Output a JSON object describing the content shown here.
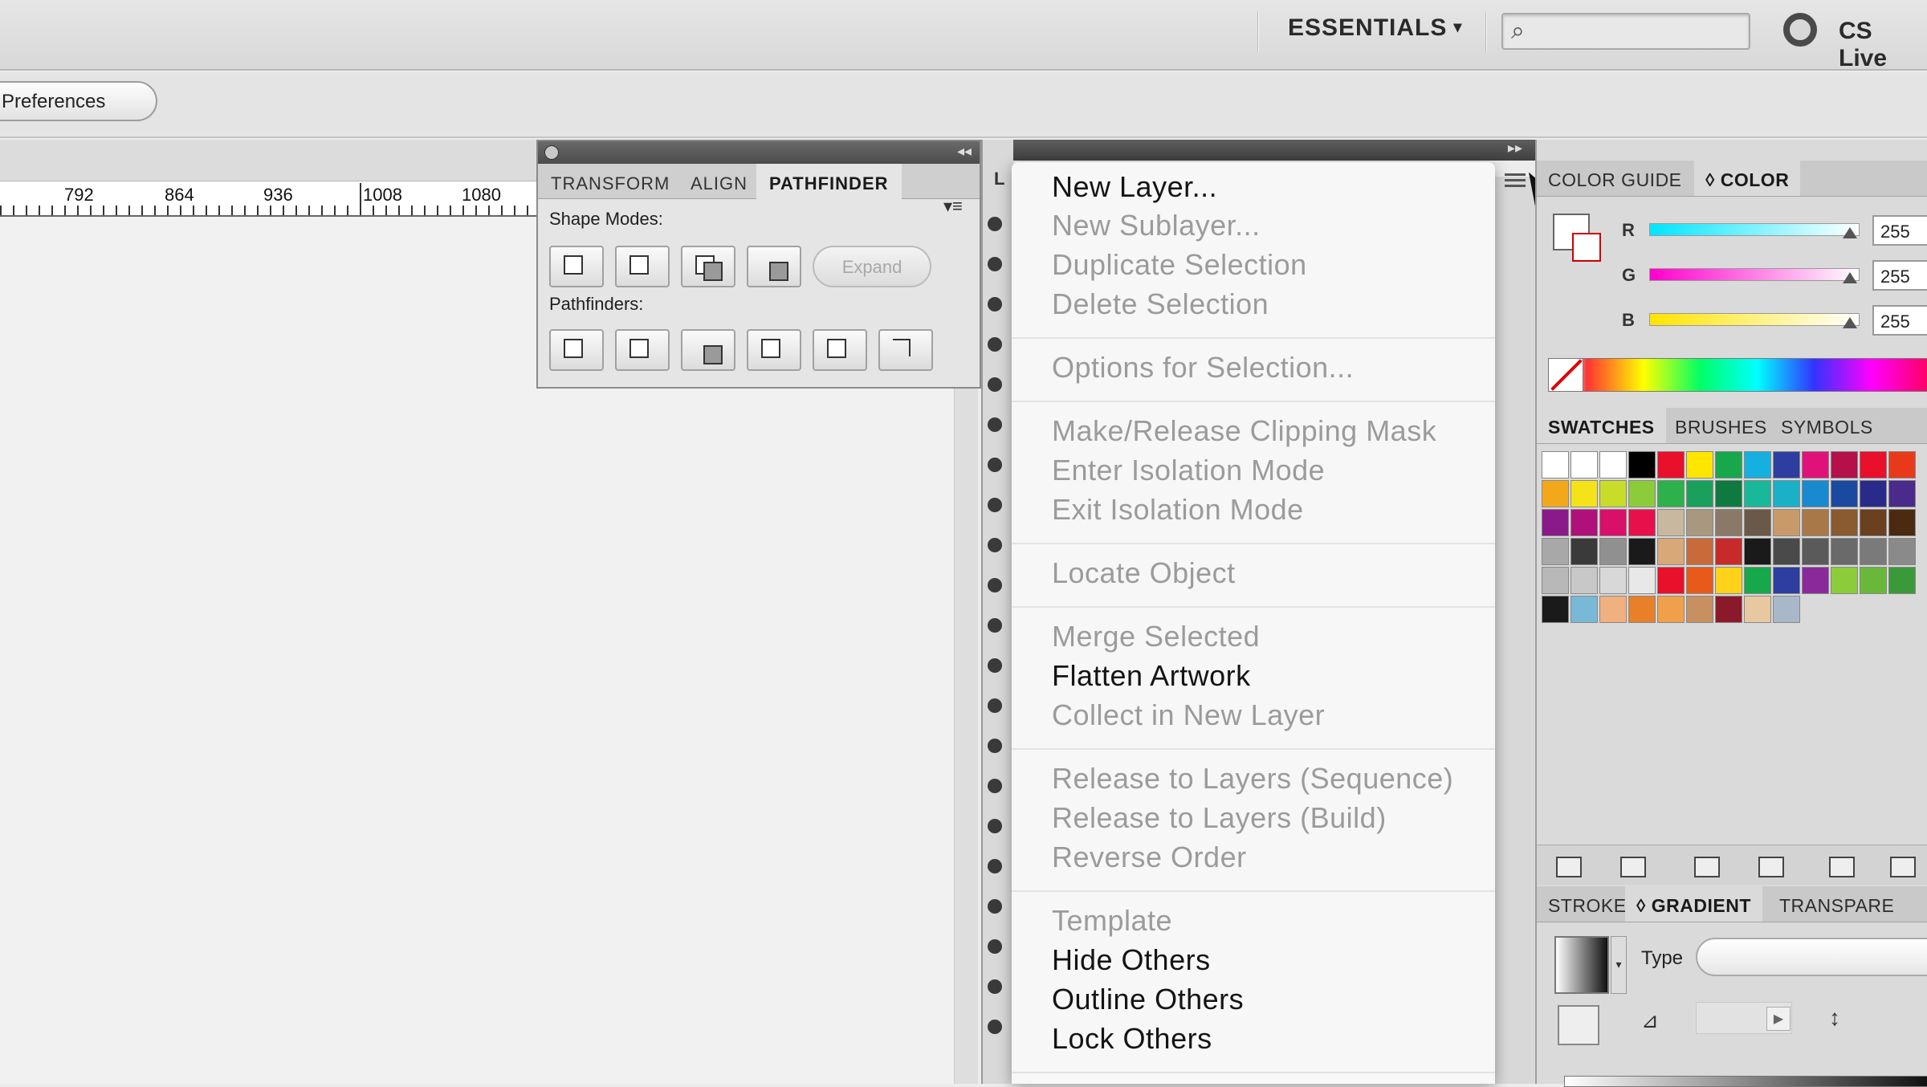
{
  "appbar": {
    "workspace": "ESSENTIALS",
    "workspace_caret": "▾",
    "search_placeholder": "",
    "search_icon": "⌕",
    "cs_live": "CS Live"
  },
  "controlbar": {
    "preferences": "Preferences"
  },
  "ruler": {
    "labels": [
      "792",
      "864",
      "936",
      "1008",
      "1080"
    ]
  },
  "pathfinder": {
    "tabs": [
      "TRANSFORM",
      "ALIGN",
      "PATHFINDER"
    ],
    "active_tab": "PATHFINDER",
    "shape_modes_label": "Shape Modes:",
    "pathfinders_label": "Pathfinders:",
    "expand": "Expand",
    "menu_icon": "▾≡"
  },
  "layers_menu": {
    "header_letter": "L",
    "items": [
      {
        "label": "New Layer...",
        "enabled": true
      },
      {
        "label": "New Sublayer...",
        "enabled": false
      },
      {
        "label": "Duplicate Selection",
        "enabled": false
      },
      {
        "label": "Delete Selection",
        "enabled": false
      },
      {
        "label": "Options for Selection...",
        "enabled": false
      },
      {
        "label": "Make/Release Clipping Mask",
        "enabled": false
      },
      {
        "label": "Enter Isolation Mode",
        "enabled": false
      },
      {
        "label": "Exit Isolation Mode",
        "enabled": false
      },
      {
        "label": "Locate Object",
        "enabled": false
      },
      {
        "label": "Merge Selected",
        "enabled": false
      },
      {
        "label": "Flatten Artwork",
        "enabled": true
      },
      {
        "label": "Collect in New Layer",
        "enabled": false
      },
      {
        "label": "Release to Layers (Sequence)",
        "enabled": false
      },
      {
        "label": "Release to Layers (Build)",
        "enabled": false
      },
      {
        "label": "Reverse Order",
        "enabled": false
      },
      {
        "label": "Template",
        "enabled": false
      },
      {
        "label": "Hide Others",
        "enabled": true
      },
      {
        "label": "Outline Others",
        "enabled": true
      },
      {
        "label": "Lock Others",
        "enabled": true
      }
    ]
  },
  "color_panel": {
    "tabs": [
      "COLOR GUIDE",
      "◊ COLOR"
    ],
    "active_tab": "◊ COLOR",
    "channels": [
      {
        "label": "R",
        "value": "255"
      },
      {
        "label": "G",
        "value": "255"
      },
      {
        "label": "B",
        "value": "255"
      }
    ]
  },
  "swatches_panel": {
    "tabs": [
      "SWATCHES",
      "BRUSHES",
      "SYMBOLS"
    ],
    "active_tab": "SWATCHES",
    "colors": [
      "#ffffff",
      "#ffffff",
      "#ffffff",
      "#000000",
      "#e8102a",
      "#ffe600",
      "#16a84a",
      "#16b0e0",
      "#2e3da0",
      "#e0127a",
      "#b5104a",
      "#e8102a",
      "#e83a1a",
      "#f2a81a",
      "#f5e31a",
      "#c8dc2a",
      "#8ccc3a",
      "#2eb04a",
      "#1aa05a",
      "#0e7a40",
      "#1ab89a",
      "#1ab0c8",
      "#1a8ad0",
      "#1a4aa0",
      "#2a2a8a",
      "#4a2a8a",
      "#8a1a8a",
      "#b0107a",
      "#d8106a",
      "#e8104a",
      "#c8b8a0",
      "#a89880",
      "#8a7868",
      "#6a5848",
      "#c89a6a",
      "#a87848",
      "#8a5a30",
      "#6a4020",
      "#4a2a10",
      "#a8a8a8",
      "#3a3a3a",
      "#909090",
      "#1a1a1a",
      "#d8a878",
      "#c86a3a",
      "#c82a2a",
      "#1a1a1a",
      "#4a4a4a",
      "#5a5a5a",
      "#6a6a6a",
      "#7a7a7a",
      "#8a8a8a",
      "#b8b8b8",
      "#c8c8c8",
      "#d8d8d8",
      "#e8e8e8",
      "#e8102a",
      "#e85a1a",
      "#ffd21a",
      "#16a84a",
      "#2e3da0",
      "#8a2a9a",
      "#8ccc3a",
      "#6ab83a",
      "#3a9a3a",
      "#1a1a1a",
      "#7ab8d8",
      "#f0b080",
      "#e8802a",
      "#f0a04a",
      "#c89060",
      "#8a1a2a",
      "#e8c8a0",
      "#a8b8c8"
    ]
  },
  "stroke_gradient_panel": {
    "tabs": [
      "STROKE",
      "◊ GRADIENT",
      "TRANSPARE"
    ],
    "active_tab": "◊ GRADIENT",
    "type_label": "Type"
  }
}
